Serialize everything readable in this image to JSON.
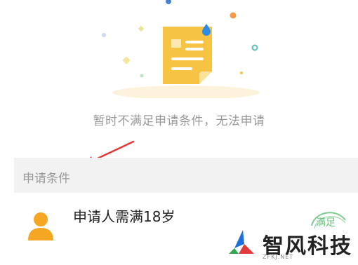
{
  "empty_state": {
    "message": "暂时不满足申请条件，无法申请",
    "illustration_icon": "document-icon"
  },
  "section": {
    "title": "申请条件"
  },
  "requirements": [
    {
      "icon": "person-icon",
      "text": "申请人需满18岁",
      "status_stamp": "满足"
    }
  ],
  "watermark": {
    "brand": "智风科技",
    "domain": "ZFKJ.NET"
  },
  "colors": {
    "doc_yellow": "#F7C343",
    "person_orange": "#F5A623",
    "stamp_green": "#3DAE5A",
    "muted_text": "#999999",
    "section_bg": "#F2F2F2",
    "arrow_red": "#E53935",
    "accent_blue": "#2F8BE8"
  }
}
